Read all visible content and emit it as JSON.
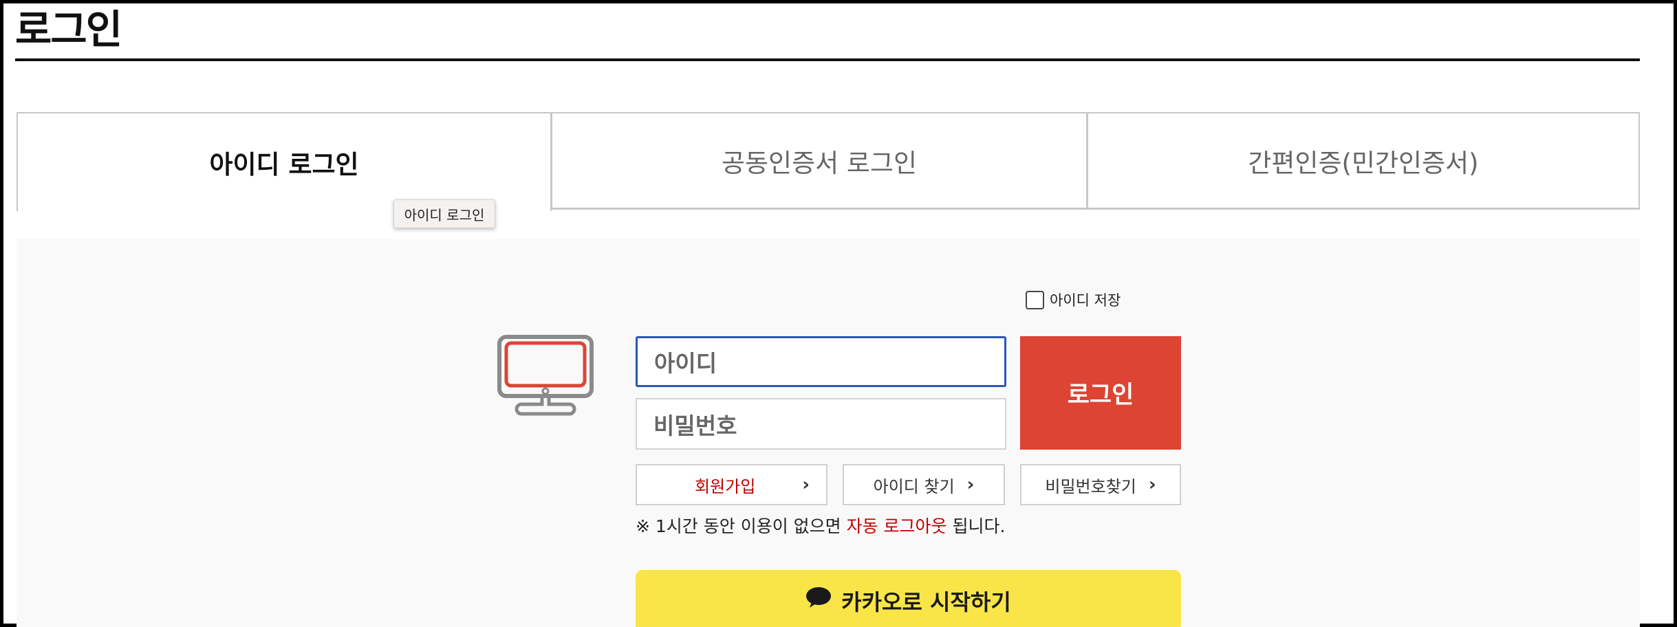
{
  "page": {
    "title": "로그인"
  },
  "tabs": [
    {
      "label": "아이디 로그인",
      "active": true
    },
    {
      "label": "공동인증서 로그인",
      "active": false
    },
    {
      "label": "간편인증(민간인증서)",
      "active": false
    }
  ],
  "tooltip": {
    "text": "아이디 로그인"
  },
  "form": {
    "save_id_label": "아이디 저장",
    "save_id_checked": false,
    "id_placeholder": "아이디",
    "password_placeholder": "비밀번호",
    "login_button": "로그인"
  },
  "links": {
    "join": "회원가입",
    "find_id": "아이디 찾기",
    "find_password": "비밀번호찾기"
  },
  "notice": {
    "prefix": "※ 1시간 동안 이용이 없으면 ",
    "highlight": "자동 로그아웃",
    "suffix": " 됩니다."
  },
  "kakao": {
    "label": "카카오로 시작하기"
  },
  "colors": {
    "accent_red": "#dd4434",
    "focus_blue": "#2b55c0",
    "kakao_yellow": "#f9e547",
    "link_red": "#c00000"
  },
  "icons": {
    "monitor": "monitor-icon",
    "chevron": "chevron-right-icon",
    "kakao": "speech-bubble-icon"
  }
}
